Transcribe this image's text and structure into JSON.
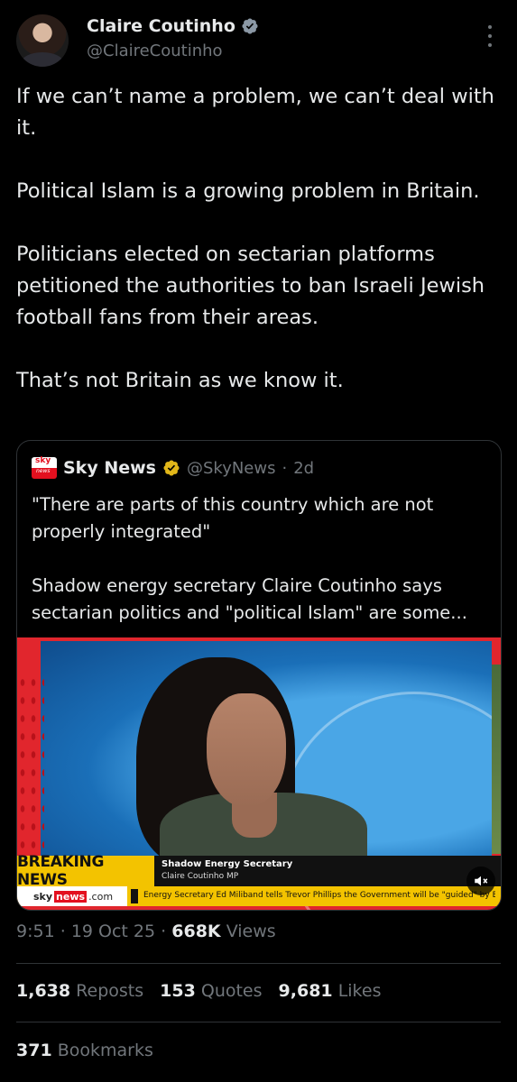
{
  "author": {
    "name": "Claire Coutinho",
    "handle": "@ClaireCoutinho"
  },
  "tweet": {
    "paragraphs": [
      "If we can’t name a problem, we can’t deal with it.",
      "Political Islam is a growing problem in Britain.",
      "Politicians elected on sectarian platforms petitioned the authorities to ban Israeli Jewish football fans from their areas.",
      "That’s not Britain as we know it."
    ]
  },
  "quote": {
    "name": "Sky News",
    "handle": "@SkyNews",
    "separator": "·",
    "age": "2d",
    "paragraphs": [
      "\"There are parts of this country which are not properly integrated\"",
      "Shadow energy secretary Claire Coutinho says sectarian politics and \"political Islam\" are some..."
    ],
    "video": {
      "breaking": "BREAKING NEWS",
      "lower_title": "Shadow Energy Secretary",
      "lower_sub": "Claire Coutinho MP",
      "brand_sky": "sky",
      "brand_news": "news",
      "brand_com": ".com",
      "ticker": "Energy Secretary Ed Miliband tells Trevor Phillips the Government will be \"guided\" by E"
    }
  },
  "meta": {
    "time": "9:51",
    "date": "19 Oct 25",
    "dot": "·",
    "views_count": "668K",
    "views_label": "Views"
  },
  "stats": {
    "reposts_count": "1,638",
    "reposts_label": "Reposts",
    "quotes_count": "153",
    "quotes_label": "Quotes",
    "likes_count": "9,681",
    "likes_label": "Likes",
    "bookmarks_count": "371",
    "bookmarks_label": "Bookmarks"
  },
  "colors": {
    "background": "#000000",
    "text": "#e7e9ea",
    "secondary": "#71767b",
    "verified_blue": "#1d9bf0",
    "verified_gold": "#e2b719",
    "sky_red": "#e3101f",
    "breaking_yellow": "#f3c300"
  },
  "icons": {
    "verified": "verified-badge-icon",
    "gold_verified": "gold-verified-badge-icon",
    "more": "more-vertical-icon",
    "mute": "volume-muted-icon"
  }
}
